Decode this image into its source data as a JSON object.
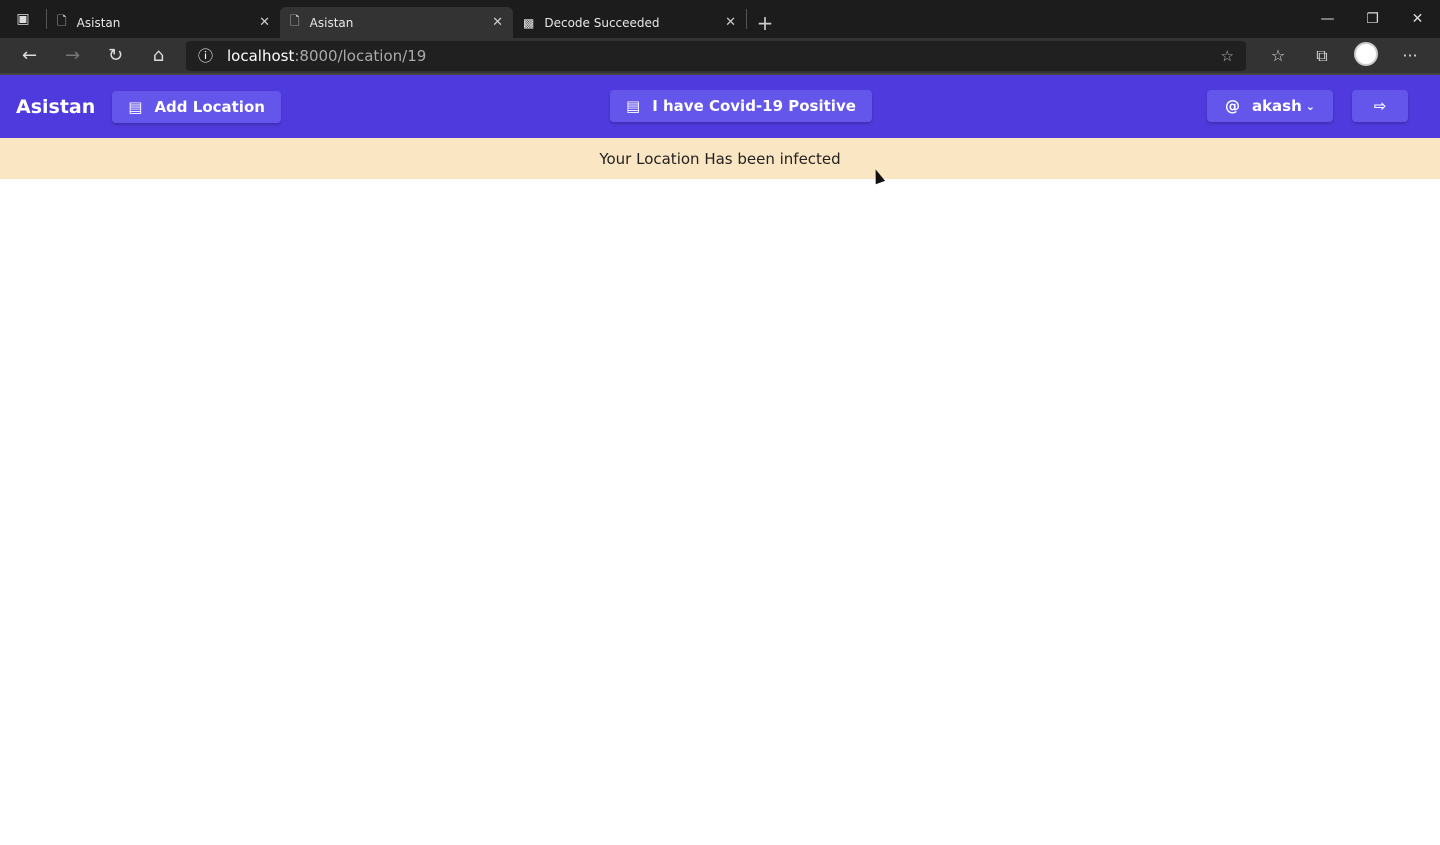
{
  "browser": {
    "tabs": [
      {
        "label": "Asistan",
        "active": false
      },
      {
        "label": "Asistan",
        "active": true
      },
      {
        "label": "Decode Succeeded",
        "active": false
      }
    ],
    "url_host": "localhost",
    "url_path": ":8000/location/19"
  },
  "header": {
    "brand": "Asistan",
    "add_location": "Add Location",
    "covid_positive": "I have Covid-19 Positive",
    "user": "akash",
    "accent": "#4f3ade"
  },
  "alert": {
    "message": "Your Location Has been infected",
    "color": "#fbe6c3"
  }
}
